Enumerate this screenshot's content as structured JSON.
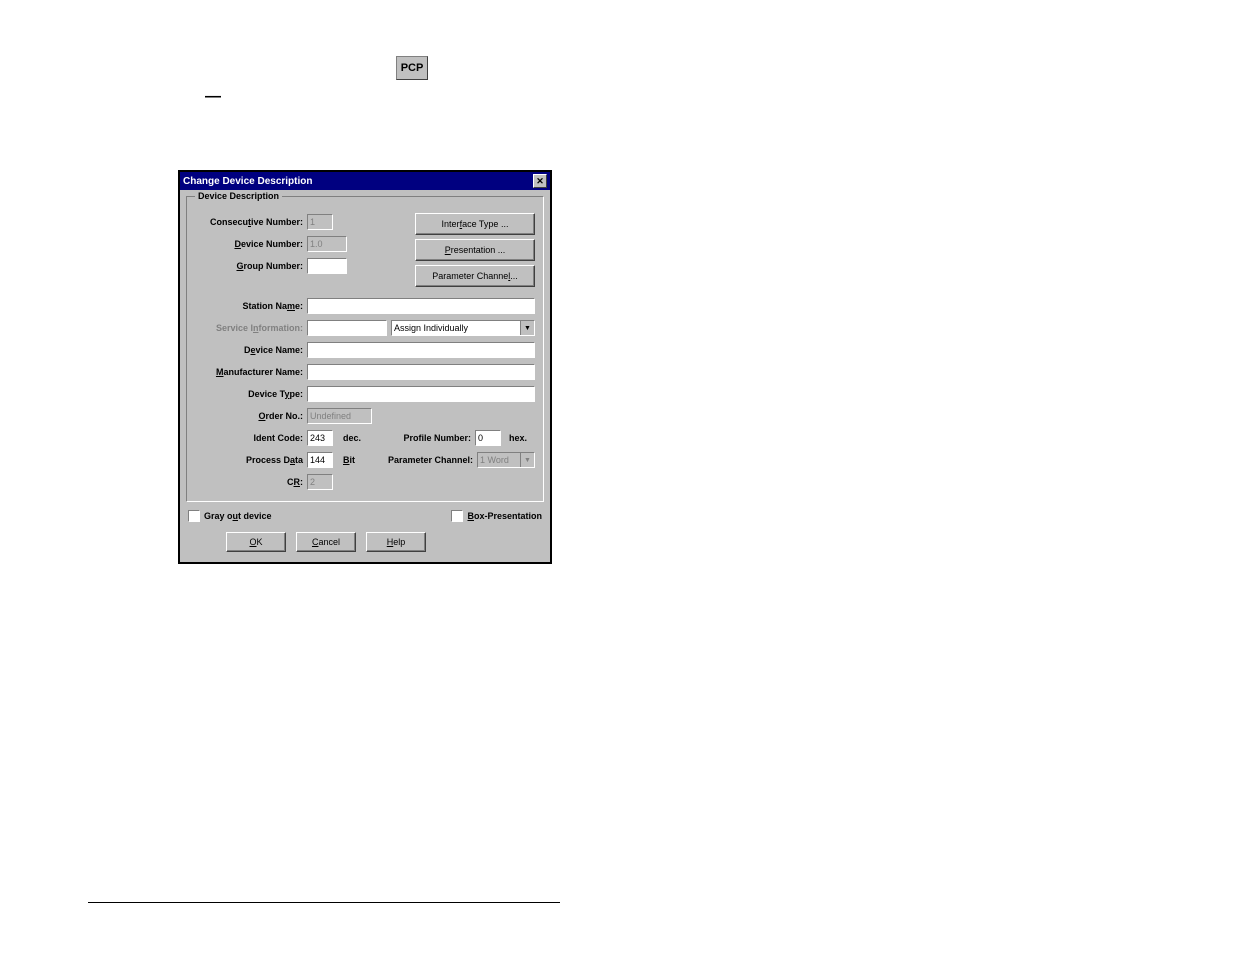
{
  "header": {
    "pcp": "PCP",
    "dash": "—"
  },
  "dialog": {
    "title": "Change Device Description",
    "group_label": "Device Description"
  },
  "fields": {
    "consecutive": {
      "label_pre": "Consecu",
      "label_u": "t",
      "label_post": "ive Number:",
      "value": "1"
    },
    "device_number": {
      "label_u": "D",
      "label_post": "evice Number:",
      "value": "1.0"
    },
    "group_number": {
      "label_u": "G",
      "label_post": "roup Number:",
      "value": ""
    },
    "station_name": {
      "label_pre": "Station Na",
      "label_u": "m",
      "label_post": "e:",
      "value": ""
    },
    "service_info": {
      "label_pre": "Service I",
      "label_u": "n",
      "label_post": "formation:",
      "value": "",
      "select": "Assign Individually"
    },
    "device_name": {
      "label_pre": "D",
      "label_u": "e",
      "label_post": "vice Name:",
      "value": ""
    },
    "manufacturer": {
      "label_u": "M",
      "label_post": "anufacturer Name:",
      "value": ""
    },
    "device_type": {
      "label_pre": "Device T",
      "label_u": "y",
      "label_post": "pe:",
      "value": ""
    },
    "order_no": {
      "label_u": "O",
      "label_post": "rder No.:",
      "value": "Undefined"
    },
    "ident_code": {
      "label": "Ident Code:",
      "value": "243",
      "unit": "dec."
    },
    "profile_number": {
      "label": "Profile Number:",
      "value": "0",
      "unit": "hex."
    },
    "process_data": {
      "label_pre": "Process D",
      "label_u": "a",
      "label_post": "ta",
      "value": "144",
      "unit_u": "B",
      "unit_post": "it"
    },
    "param_channel": {
      "label": "Parameter Channel:",
      "value": "1 Word"
    },
    "cr": {
      "label_pre": "C",
      "label_u": "R",
      "label_post": ":",
      "value": "2"
    }
  },
  "checkboxes": {
    "gray_out": {
      "pre": "Gray o",
      "u": "u",
      "post": "t device"
    },
    "box_pres": {
      "u": "B",
      "post": "ox-Presentation"
    }
  },
  "buttons": {
    "interface_pre": "Inter",
    "interface_u": "f",
    "interface_post": "ace Type ...",
    "presentation_u": "P",
    "presentation_post": "resentation ...",
    "param_pre": "Parameter Channe",
    "param_u": "l",
    "param_post": " ...",
    "ok_u": "O",
    "ok_post": "K",
    "cancel_u": "C",
    "cancel_post": "ancel",
    "help_u": "H",
    "help_post": "elp"
  }
}
